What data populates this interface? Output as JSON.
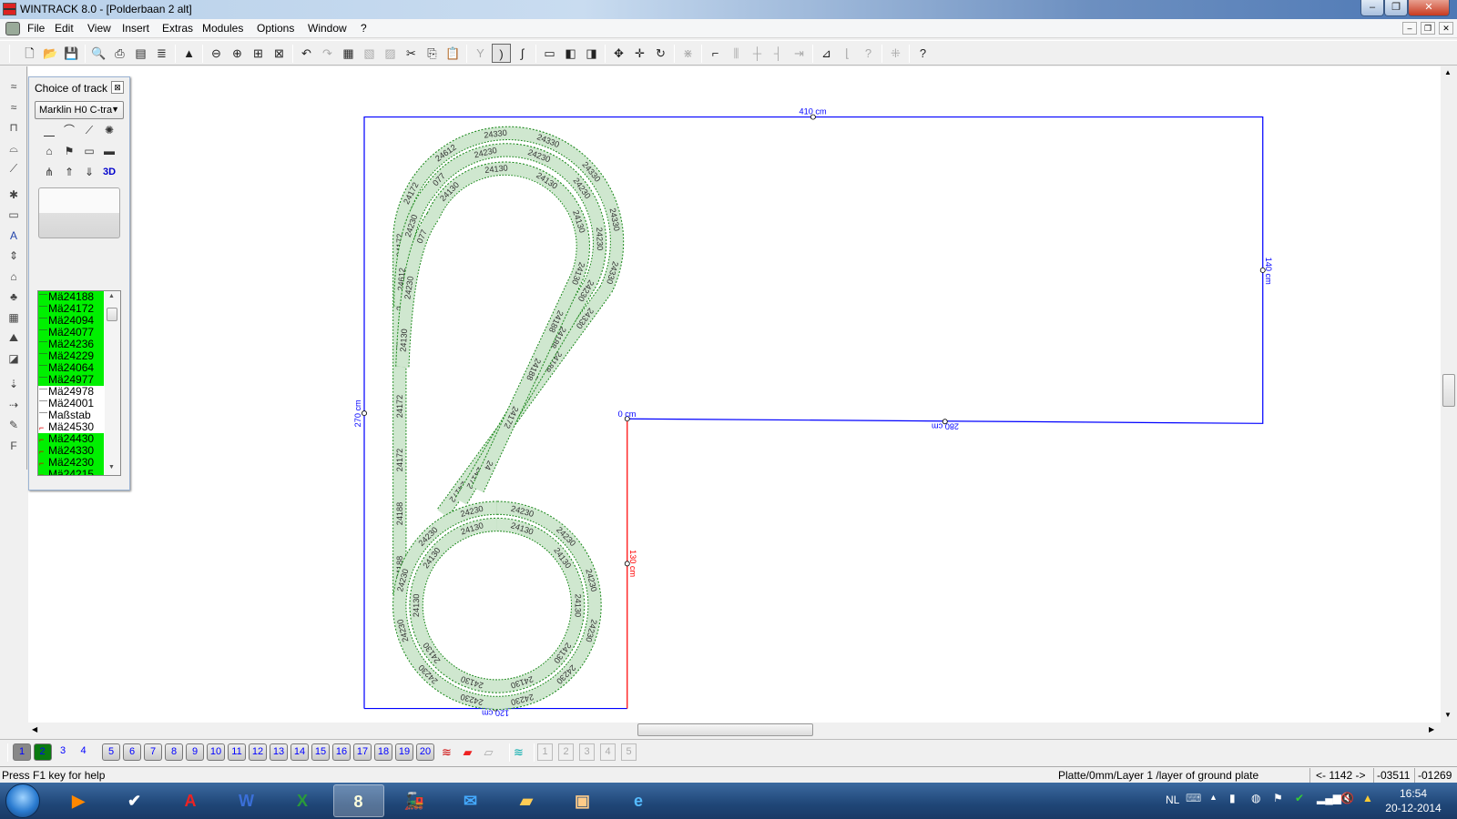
{
  "window": {
    "title": "WINTRACK 8.0 - [Polderbaan 2 alt]",
    "minimize": "–",
    "restore": "❐",
    "close": "✕"
  },
  "menu": {
    "items": [
      "File",
      "Edit",
      "View",
      "Insert",
      "Extras",
      "Modules",
      "Options",
      "Window",
      "?"
    ],
    "mdi": [
      "–",
      "❐",
      "✕"
    ]
  },
  "toolbar": {
    "buttons": [
      {
        "name": "new-file-icon",
        "g": "🗋"
      },
      {
        "name": "open-folder-icon",
        "g": "📂"
      },
      {
        "name": "save-icon",
        "g": "💾"
      },
      {
        "sep": true
      },
      {
        "name": "print-preview-icon",
        "g": "🔍"
      },
      {
        "name": "print-icon",
        "g": "⎙"
      },
      {
        "name": "print-setup-icon",
        "g": "▤"
      },
      {
        "name": "parts-list-icon",
        "g": "≣"
      },
      {
        "sep": true
      },
      {
        "name": "picture-icon",
        "g": "▲"
      },
      {
        "sep": true
      },
      {
        "name": "zoom-out-icon",
        "g": "⊖"
      },
      {
        "name": "zoom-in-icon",
        "g": "⊕"
      },
      {
        "name": "zoom-window-icon",
        "g": "⊞"
      },
      {
        "name": "zoom-fit-icon",
        "g": "⊠"
      },
      {
        "sep": true
      },
      {
        "name": "undo-icon",
        "g": "↶"
      },
      {
        "name": "redo-icon",
        "g": "↷",
        "dis": true
      },
      {
        "name": "document-red-icon",
        "g": "▦"
      },
      {
        "name": "copy-page-icon",
        "g": "▧",
        "dis": true
      },
      {
        "name": "paste-page-icon",
        "g": "▨",
        "dis": true
      },
      {
        "name": "cut-icon",
        "g": "✂"
      },
      {
        "name": "copy-icon",
        "g": "⎘"
      },
      {
        "name": "paste-icon",
        "g": "📋",
        "dis": true
      },
      {
        "sep": true
      },
      {
        "name": "switch-icon",
        "g": "Y",
        "dis": true
      },
      {
        "name": "curve-track-icon",
        "g": ")",
        "act": true
      },
      {
        "name": "flex-track-icon",
        "g": "∫"
      },
      {
        "sep": true
      },
      {
        "name": "insert-object-icon",
        "g": "▭"
      },
      {
        "name": "bring-front-icon",
        "g": "◧"
      },
      {
        "name": "send-back-icon",
        "g": "◨"
      },
      {
        "sep": true
      },
      {
        "name": "move-icon",
        "g": "✥"
      },
      {
        "name": "move-object-icon",
        "g": "✛"
      },
      {
        "name": "rotate-180-icon",
        "g": "↻"
      },
      {
        "sep": true
      },
      {
        "name": "connect-icon",
        "g": "⋇",
        "dis": true
      },
      {
        "sep": true
      },
      {
        "name": "height-icon",
        "g": "⌐"
      },
      {
        "name": "split-icon",
        "g": "⫼",
        "dis": true
      },
      {
        "name": "join-icon",
        "g": "┼",
        "dis": true
      },
      {
        "name": "branch-icon",
        "g": "┤",
        "dis": true
      },
      {
        "name": "align-icon",
        "g": "⇥",
        "dis": true
      },
      {
        "sep": true
      },
      {
        "name": "measure-icon",
        "g": "⊿"
      },
      {
        "name": "measure-line-icon",
        "g": "⌊",
        "dis": true
      },
      {
        "name": "measure-query-icon",
        "g": "?",
        "dis": true
      },
      {
        "sep": true
      },
      {
        "name": "snap-icon",
        "g": "⁜",
        "dis": true
      },
      {
        "sep": true
      },
      {
        "name": "help-pointer-icon",
        "g": "?"
      }
    ]
  },
  "lefttools": [
    "flex-track-icon",
    "flex-track-2-icon",
    "tunnel-icon",
    "bridge-icon",
    "ramp-icon",
    "catenary-icon",
    "platform-icon",
    "text-icon",
    "height-marker-icon",
    "building-icon",
    "tree-icon",
    "terrain-icon",
    "landscape-icon",
    "contour-icon",
    "measure-vertical-icon",
    "measure-horizontal-icon",
    "paint-icon",
    "font-icon"
  ],
  "panel": {
    "title": "Choice of track",
    "close": "⊠",
    "system": "Marklin H0 C-tra",
    "icons": [
      {
        "name": "straight-track-icon",
        "g": "⎽"
      },
      {
        "name": "curved-track-icon",
        "g": "⌒"
      },
      {
        "name": "switch-track-icon",
        "g": "⟋"
      },
      {
        "name": "turntable-icon",
        "g": "✺"
      },
      {
        "name": "building-icon",
        "g": "⌂"
      },
      {
        "name": "signal-icon",
        "g": "⚑"
      },
      {
        "name": "sign-icon",
        "g": "▭"
      },
      {
        "name": "platform-icon",
        "g": "▬"
      },
      {
        "name": "catenary-icon",
        "g": "⋔"
      },
      {
        "name": "raise-icon",
        "g": "⇑"
      },
      {
        "name": "lower-icon",
        "g": "⇓"
      },
      {
        "name": "3d-view-icon",
        "g": "3D"
      }
    ],
    "list": [
      {
        "label": "Mä24188",
        "hl": true,
        "curve": false
      },
      {
        "label": "Mä24172",
        "hl": true,
        "curve": false
      },
      {
        "label": "Mä24094",
        "hl": true,
        "curve": false
      },
      {
        "label": "Mä24077",
        "hl": true,
        "curve": false
      },
      {
        "label": "Mä24236",
        "hl": true,
        "curve": false
      },
      {
        "label": "Mä24229",
        "hl": true,
        "curve": false
      },
      {
        "label": "Mä24064",
        "hl": true,
        "curve": false
      },
      {
        "label": "Mä24977",
        "hl": true,
        "curve": false
      },
      {
        "label": "Mä24978",
        "hl": false,
        "curve": false
      },
      {
        "label": "Mä24001",
        "hl": false,
        "curve": false
      },
      {
        "label": "Maßstab",
        "hl": false,
        "curve": false
      },
      {
        "label": "Mä24530",
        "hl": false,
        "curve": true
      },
      {
        "label": "Mä24430",
        "hl": true,
        "curve": true
      },
      {
        "label": "Mä24330",
        "hl": true,
        "curve": true
      },
      {
        "label": "Mä24230",
        "hl": true,
        "curve": true
      },
      {
        "label": "Mä24215",
        "hl": true,
        "curve": true
      }
    ]
  },
  "board": {
    "color": "#0000ff",
    "module_color": "#ff0000",
    "dims": {
      "top": "410 cm",
      "right": "140 cm",
      "left": "270 cm",
      "zero": "0 cm",
      "mid": "280 cm",
      "module": "130 cm",
      "bottom": "120 cm"
    }
  },
  "tracks": [
    {
      "labels": [
        "24188",
        "24188",
        "24172",
        "24172",
        "24172",
        "24172",
        "24172",
        "24172",
        "24612",
        "24330",
        "24330",
        "24330",
        "24330",
        "24330",
        "24330",
        "24188",
        "24188",
        "24188",
        "24172"
      ]
    },
    {
      "labels": [
        "24612",
        "24230",
        "077",
        "24230",
        "24230",
        "24230",
        "24230",
        "24230",
        "24188",
        "24188",
        "24188",
        "24172"
      ]
    },
    {
      "labels": [
        "24130",
        "24230",
        "077",
        "24130",
        "24130",
        "24130",
        "24130",
        "24130",
        "24188",
        "24188",
        "24172",
        "24"
      ]
    },
    {
      "labels": [
        "24230",
        "24230",
        "24230",
        "24230",
        "24230",
        "24230",
        "24230",
        "24230",
        "24230",
        "24230",
        "24230",
        "24230"
      ]
    },
    {
      "labels": [
        "24130",
        "24130",
        "24130",
        "24130",
        "24130",
        "24130",
        "24130",
        "24130",
        "24130",
        "24130"
      ]
    }
  ],
  "track_colors": {
    "fill": "#cfe7cf",
    "edge": "#1e8a1e",
    "text": "#333333"
  },
  "bottombar": {
    "layers": [
      "1",
      "2",
      "3",
      "4",
      "5",
      "6",
      "7",
      "8",
      "9",
      "10",
      "11",
      "12",
      "13",
      "14",
      "15",
      "16",
      "17",
      "18",
      "19",
      "20"
    ],
    "layer_icons": [
      "layers-icon",
      "layer-red-icon",
      "layer-grey-icon",
      "layer-query-icon"
    ],
    "views": [
      "1",
      "2",
      "3",
      "4",
      "5"
    ]
  },
  "status": {
    "help": "Press F1 key for help",
    "layer": "Platte/0mm/Layer 1 /layer of ground plate",
    "angle": "<- 1142 ->",
    "x": "-03511",
    "y": "-01269"
  },
  "taskbar": {
    "apps": [
      {
        "name": "media-player-icon",
        "g": "▶",
        "c": "#f80"
      },
      {
        "name": "checkmark-app-icon",
        "g": "✔",
        "c": "#fff"
      },
      {
        "name": "acrobat-icon",
        "g": "A",
        "c": "#e22"
      },
      {
        "name": "word-icon",
        "g": "W",
        "c": "#3a6fd8"
      },
      {
        "name": "excel-icon",
        "g": "X",
        "c": "#2a9a3a"
      },
      {
        "name": "wintrack-icon",
        "g": "8",
        "c": "#ffd",
        "act": true
      },
      {
        "name": "train-app-icon",
        "g": "🚂",
        "c": "#fd0"
      },
      {
        "name": "mail-icon",
        "g": "✉",
        "c": "#4af"
      },
      {
        "name": "explorer-icon",
        "g": "▰",
        "c": "#fc5"
      },
      {
        "name": "folder-icon",
        "g": "▣",
        "c": "#fc8"
      },
      {
        "name": "internet-explorer-icon",
        "g": "e",
        "c": "#5bf"
      }
    ],
    "lang": "NL",
    "time": "16:54",
    "date": "20-12-2014"
  }
}
